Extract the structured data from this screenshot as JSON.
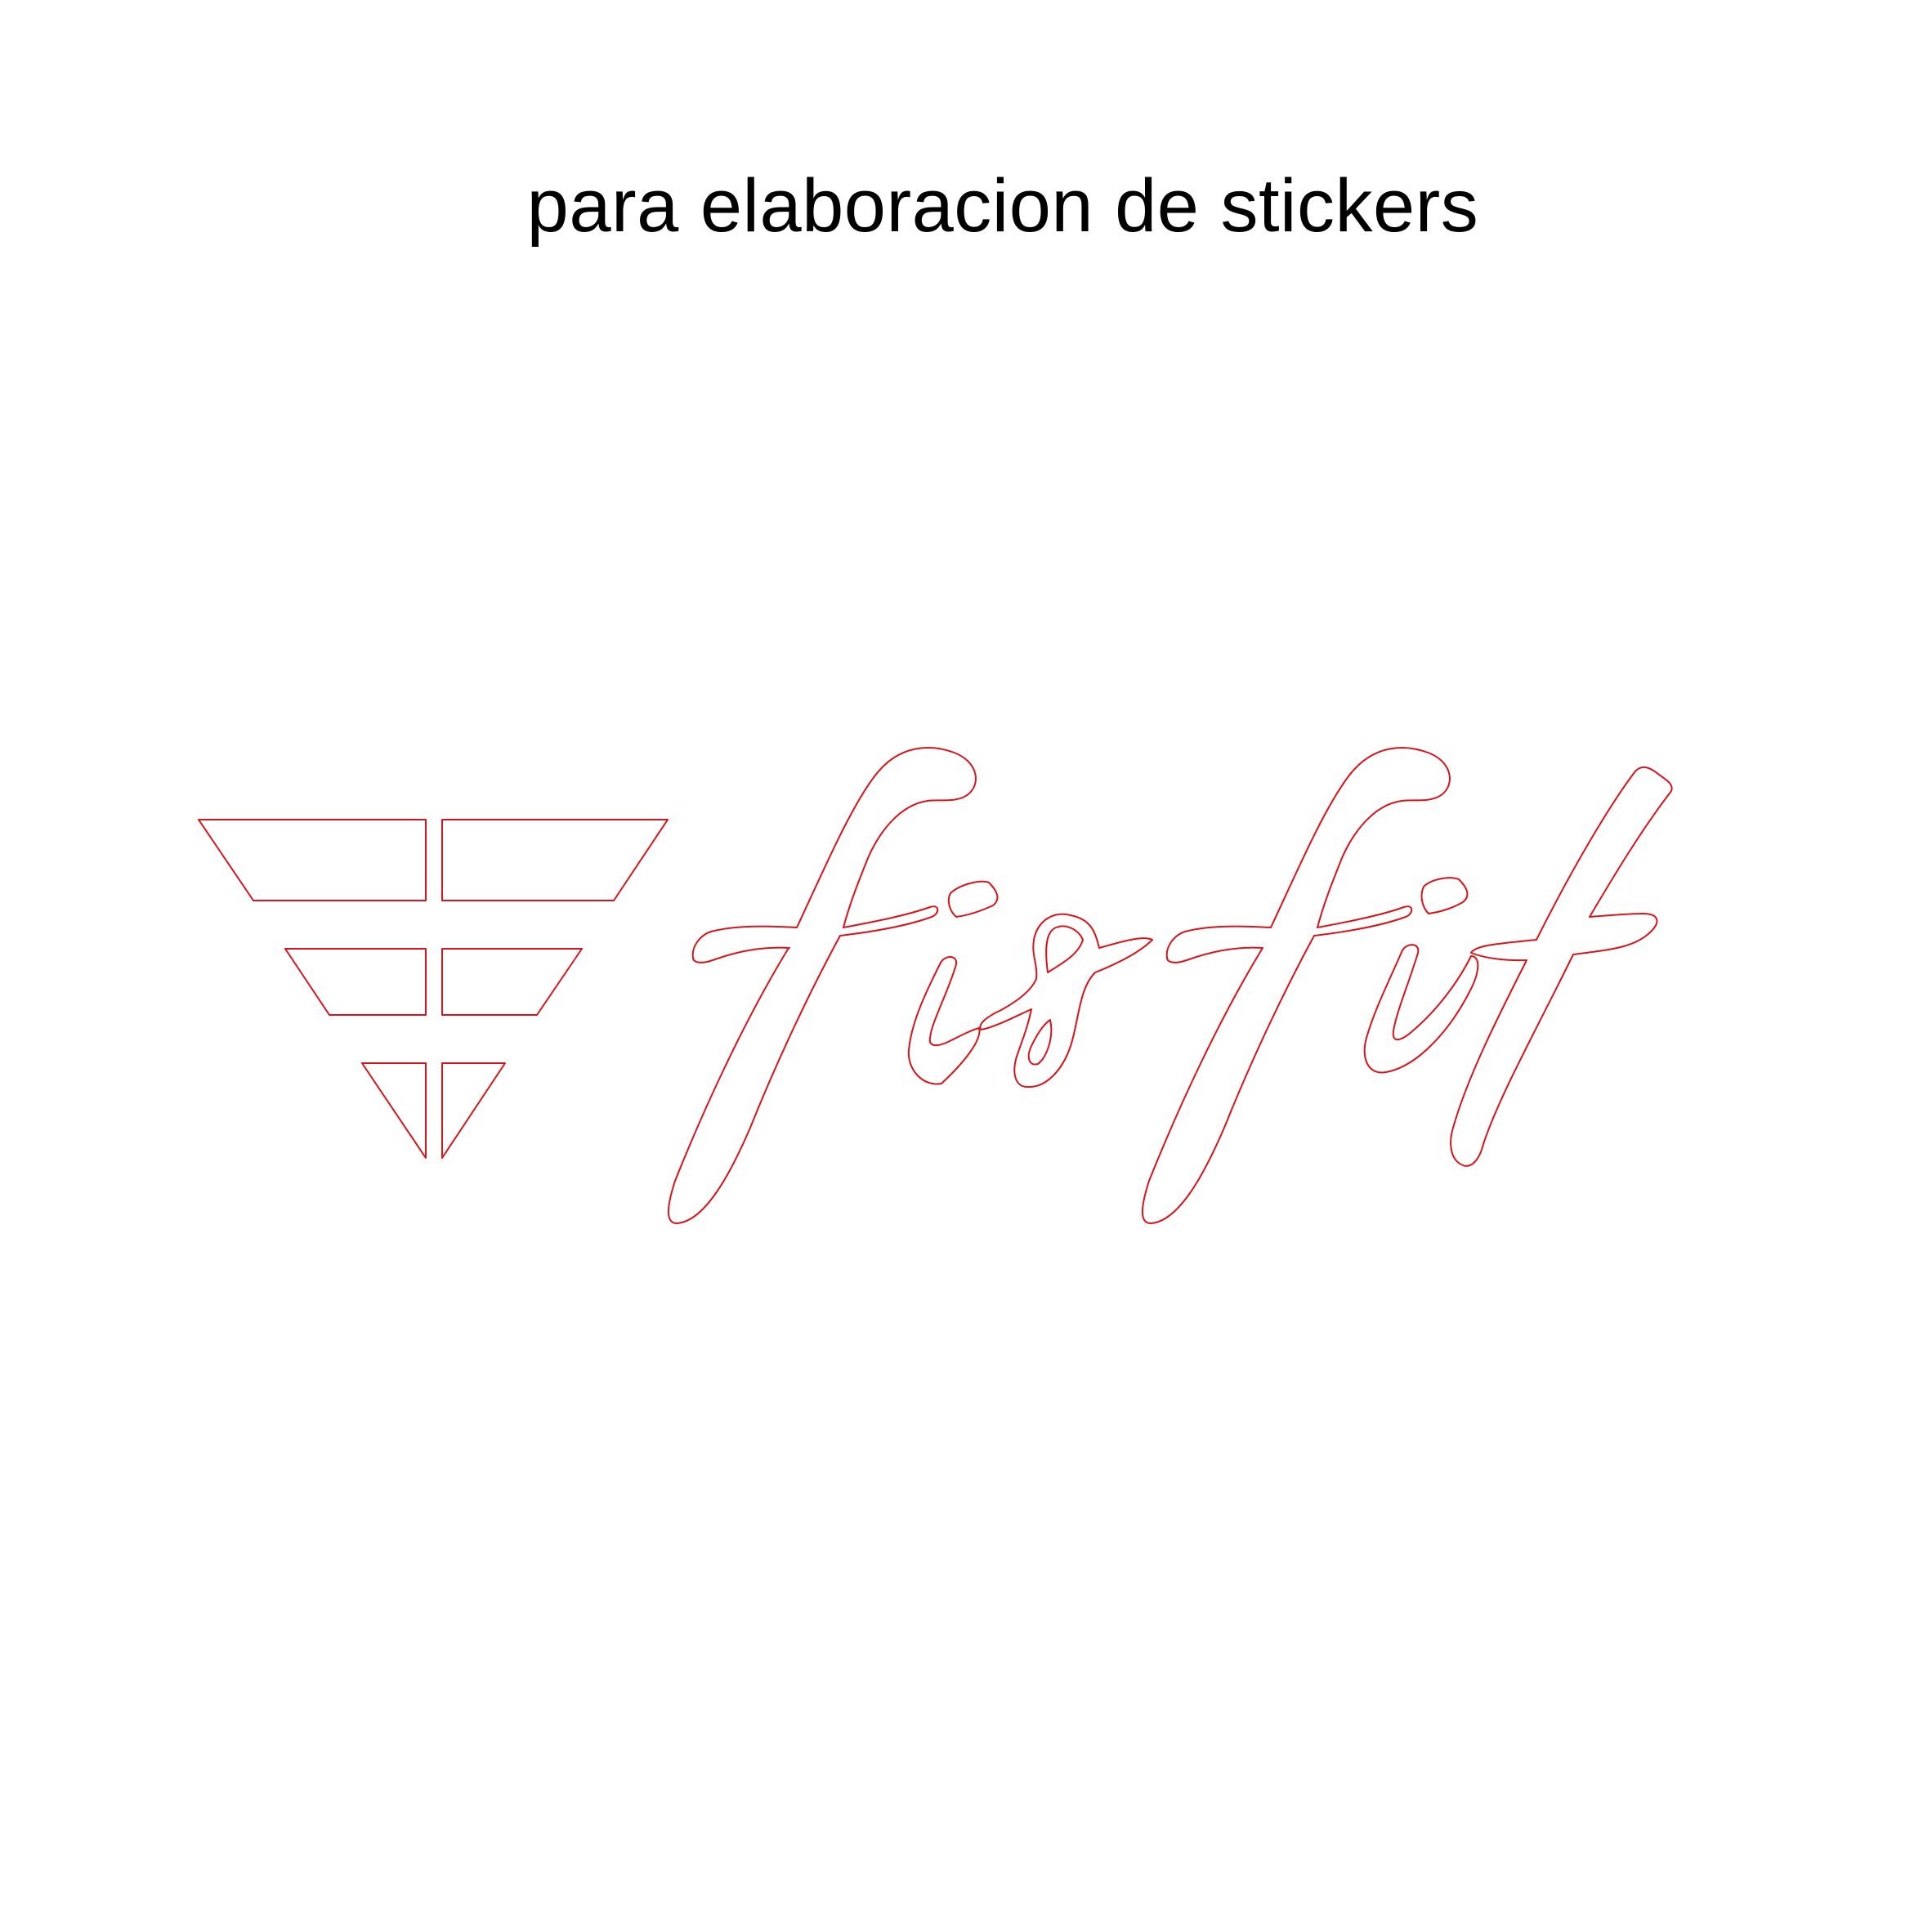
{
  "caption": "para elaboracion de stickers",
  "logo": {
    "wordmark": "fisfit",
    "icon": "stacked-trapezoid-arrow-icon",
    "outline_color": "#d7141a"
  },
  "colors": {
    "background": "#ffffff",
    "text": "#000000"
  }
}
